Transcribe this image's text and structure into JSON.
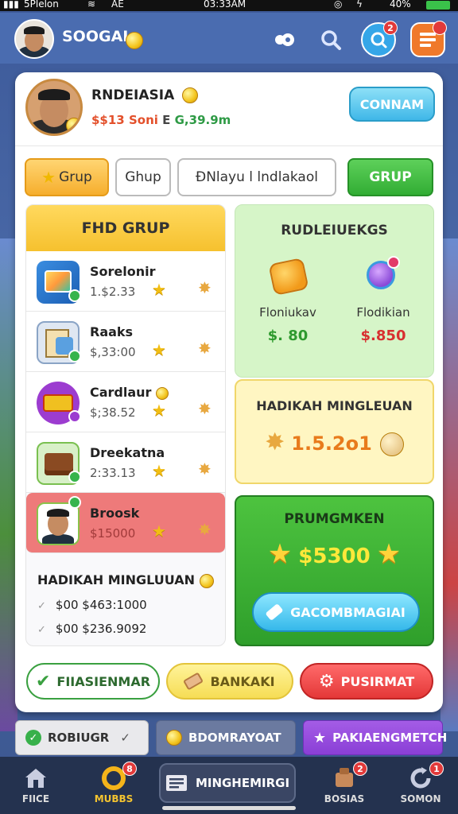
{
  "status_bar": {
    "carrier": "5Plelon",
    "network": "AE",
    "time": "03:33AM",
    "battery": "40%"
  },
  "app_bar": {
    "title": "SOOGAI"
  },
  "profile": {
    "name": "RNDEIASIA",
    "balance": "$$13 Soni",
    "stat_sep": "E",
    "gain": "G,39.9m",
    "contact_label": "CONNAM"
  },
  "tabs": [
    "Grup",
    "Ghup",
    "ÐNlayu l lndlakaol",
    "GRUP"
  ],
  "list": {
    "header": "FHD GRUP",
    "items": [
      {
        "title": "Sorelonir",
        "value": "1.$2.33"
      },
      {
        "title": "Raaks",
        "value": "$,33:00"
      },
      {
        "title": "Cardlaur",
        "value": "$;38.52"
      },
      {
        "title": "Dreekatna",
        "value": "2:33.13"
      },
      {
        "title": "Broosk",
        "value": "$15000"
      }
    ],
    "footer_title": "HADIKAH MINGLUUAN",
    "footer_lines": [
      "$00 $463:1000",
      "$00 $236.9092"
    ]
  },
  "rewards": {
    "title": "RUDLEIUEKGS",
    "items": [
      {
        "label": "Floniukav",
        "price": "$. 80",
        "color": "#2e9a2e"
      },
      {
        "label": "Flodikian",
        "price": "$.850",
        "color": "#d83030"
      }
    ]
  },
  "weekly": {
    "title": "HADIKAH MINGLEUAN",
    "value": "1.5.2o1"
  },
  "premium": {
    "title": "PRUMGMKEN",
    "value": "$5300",
    "button_label": "GACOMBMAGIAI"
  },
  "actions": [
    "FIIASIENMAR",
    "BANKAKI",
    "PUSIRMAT"
  ],
  "quick_bar": [
    "ROBIUGR",
    "BDOMRAYOAT",
    "PAKIAENGMETCH"
  ],
  "bottom_nav": {
    "items": [
      {
        "label": "FIICE"
      },
      {
        "label": "MUBBS"
      },
      {
        "label": "BOSIAS"
      },
      {
        "label": "SOMON"
      }
    ],
    "center_label": "MINGHEMIRGI"
  },
  "badges": {
    "chat": "2",
    "nav_mubbs": "8",
    "nav_bosias": "2",
    "nav_somon": "1"
  },
  "icons": [
    "search-icon",
    "chat-icon",
    "menu-icon",
    "home-icon",
    "star-icon",
    "coin-icon",
    "leaf-icon",
    "check-icon",
    "pencil-icon",
    "gear-icon",
    "stamp-icon"
  ]
}
